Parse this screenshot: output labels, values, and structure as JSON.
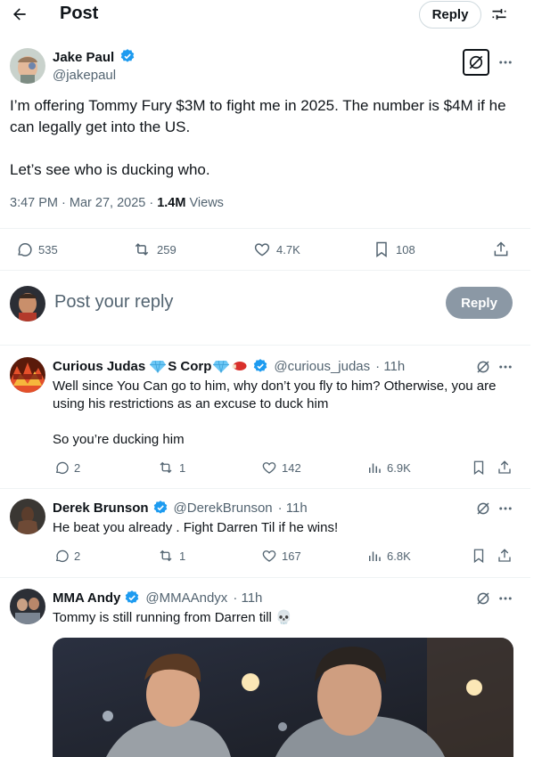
{
  "header": {
    "title": "Post",
    "reply_button": "Reply"
  },
  "post": {
    "author_name": "Jake Paul",
    "author_handle": "@jakepaul",
    "text": "I’m offering Tommy Fury $3M to fight me in 2025. The number is $4M if he can legally get into the US.\n\nLet’s see who is ducking who.",
    "time": "3:47 PM · Mar 27, 2025 · ",
    "views_count": "1.4M",
    "views_label": " Views",
    "replies": "535",
    "reposts": "259",
    "likes": "4.7K",
    "bookmarks": "108"
  },
  "composer": {
    "placeholder": "Post your reply",
    "button": "Reply"
  },
  "replies": [
    {
      "name": "Curious Judas",
      "name_suffix": "S Corp",
      "handle": "@curious_judas",
      "time": "· 11h",
      "text": "Well since You Can go to him, why don’t you fly to him?  Otherwise, you are using his restrictions as an excuse to duck him\n\nSo you’re ducking him",
      "replies": "2",
      "reposts": "1",
      "likes": "142",
      "views": "6.9K"
    },
    {
      "name": "Derek Brunson",
      "handle": "@DerekBrunson",
      "time": "· 11h",
      "text": "He beat you already . Fight Darren Til if he wins!",
      "replies": "2",
      "reposts": "1",
      "likes": "167",
      "views": "6.8K"
    },
    {
      "name": "MMA Andy",
      "handle": "@MMAAndyx",
      "time": "· 11h",
      "text": "Tommy is still running from Darren till 💀"
    }
  ],
  "colors": {
    "accent": "#1d9bf0",
    "muted": "#536471",
    "text": "#0f1419",
    "divider": "#eff3f4"
  }
}
